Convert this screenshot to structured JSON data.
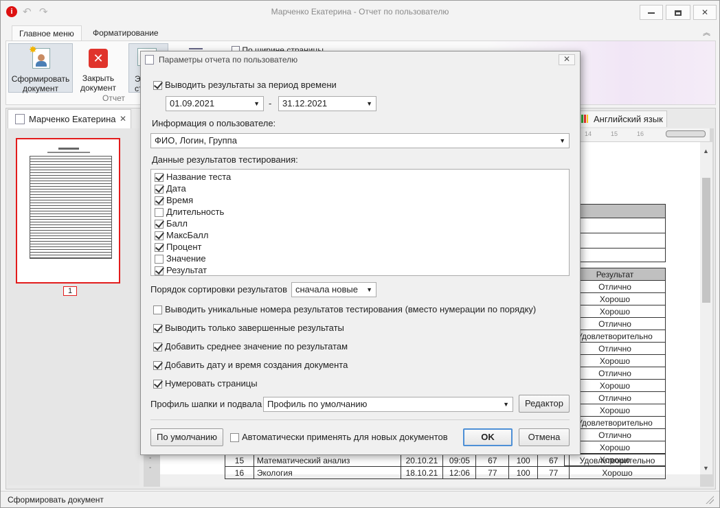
{
  "window": {
    "title": "Марченко Екатерина - Отчет по пользователю",
    "controls": {
      "minimize": "▭",
      "maximize": "□",
      "close": "✕"
    }
  },
  "ribbon": {
    "tabs": [
      "Главное меню",
      "Форматирование"
    ],
    "buttons": [
      {
        "label": "Сформировать документ",
        "icon": "generate-document-icon"
      },
      {
        "label": "Закрыть документ",
        "icon": "close-document-icon"
      }
    ],
    "partial_labels": {
      "third": "Э",
      "third_sub": "ст",
      "width_label": "По ширине страницы"
    },
    "group_label": "Отчет"
  },
  "document_tab": {
    "label": "Марченко Екатерина",
    "close": "✕"
  },
  "second_tab": {
    "label": "Английский язык"
  },
  "thumbnail": {
    "page_number": "1"
  },
  "ruler": {
    "marks": [
      "14",
      "15",
      "16"
    ]
  },
  "report_table": {
    "header_result": "Результат",
    "results": [
      "Отлично",
      "Хорошо",
      "Хорошо",
      "Отлично",
      "Удовлетворительно",
      "Отлично",
      "Хорошо",
      "Отлично",
      "Хорошо",
      "Отлично",
      "Хорошо",
      "Удовлетворительно",
      "Отлично",
      "Хорошо",
      "Хорошо"
    ],
    "rows_full": [
      {
        "num": "15",
        "name": "Математический анализ",
        "date": "20.10.21",
        "time": "09:05",
        "score": "67",
        "max": "100",
        "percent": "67",
        "result": "Удовлетворительно"
      },
      {
        "num": "16",
        "name": "Экология",
        "date": "18.10.21",
        "time": "12:06",
        "score": "77",
        "max": "100",
        "percent": "77",
        "result": "Хорошо"
      }
    ]
  },
  "status": {
    "text": "Сформировать документ"
  },
  "dialog": {
    "title": "Параметры отчета по пользователю",
    "close": "✕",
    "period_label": "Выводить результаты за период времени",
    "period_checked": true,
    "date_from": "01.09.2021",
    "date_dash": "-",
    "date_to": "31.12.2021",
    "user_info_label": "Информация о пользователе:",
    "user_info_value": "ФИО, Логин, Группа",
    "test_data_label": "Данные результатов тестирования:",
    "test_fields": [
      {
        "label": "Название теста",
        "checked": true
      },
      {
        "label": "Дата",
        "checked": true
      },
      {
        "label": "Время",
        "checked": true
      },
      {
        "label": "Длительность",
        "checked": false
      },
      {
        "label": "Балл",
        "checked": true
      },
      {
        "label": "МаксБалл",
        "checked": true
      },
      {
        "label": "Процент",
        "checked": true
      },
      {
        "label": "Значение",
        "checked": false
      },
      {
        "label": "Результат",
        "checked": true
      }
    ],
    "sort_label": "Порядок сортировки результатов",
    "sort_value": "сначала новые",
    "options": [
      {
        "label": "Выводить уникальные номера результатов тестирования (вместо нумерации по порядку)",
        "checked": false
      },
      {
        "label": "Выводить только завершенные результаты",
        "checked": true
      },
      {
        "label": "Добавить среднее значение по результатам",
        "checked": true
      },
      {
        "label": "Добавить дату и время создания документа",
        "checked": true
      },
      {
        "label": "Нумеровать страницы",
        "checked": true
      }
    ],
    "profile_label": "Профиль шапки и подвала",
    "profile_value": "Профиль по умолчанию",
    "editor_button": "Редактор",
    "default_button": "По умолчанию",
    "auto_apply_label": "Автоматически применять для новых документов",
    "auto_apply_checked": false,
    "ok_button": "OK",
    "cancel_button": "Отмена"
  }
}
